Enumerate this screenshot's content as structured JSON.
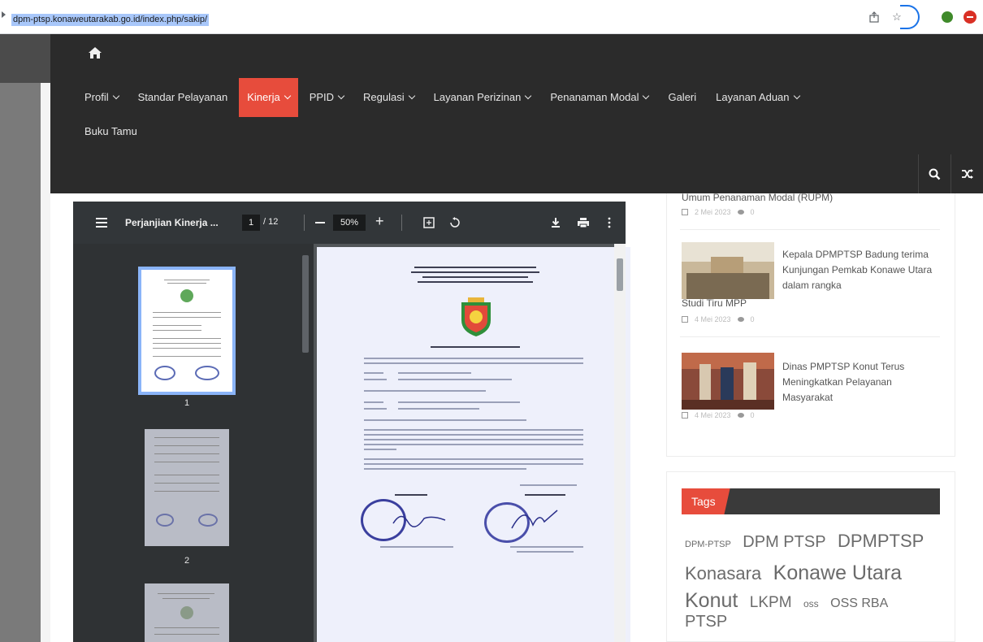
{
  "browser": {
    "url": "dpm-ptsp.konawеutarakab.go.id/index.php/sakip/"
  },
  "navbar": {
    "items": [
      {
        "label": "Profil",
        "has_dropdown": true
      },
      {
        "label": "Standar Pelayanan",
        "has_dropdown": false
      },
      {
        "label": "Kinerja",
        "has_dropdown": true,
        "active": true
      },
      {
        "label": "PPID",
        "has_dropdown": true
      },
      {
        "label": "Regulasi",
        "has_dropdown": true
      },
      {
        "label": "Layanan Perizinan",
        "has_dropdown": true
      },
      {
        "label": "Penanaman Modal",
        "has_dropdown": true
      },
      {
        "label": "Galeri",
        "has_dropdown": false
      },
      {
        "label": "Layanan Aduan",
        "has_dropdown": true
      }
    ],
    "row2_item": "Buku Tamu",
    "accent": "#e74c3c"
  },
  "pdf": {
    "title": "Perjanjian Kinerja ...",
    "page_current": "1",
    "page_total": "/ 12",
    "zoom": "50%",
    "thumb_numbers": [
      "1",
      "2"
    ]
  },
  "sidebar": {
    "cut_title": "Umum Penanaman Modal (RUPM)",
    "meta1": "2 Mei 2023",
    "meta1_comments": "0",
    "news": [
      {
        "title_part1": "Kepala DPMPTSP Badung terima Kunjungan Pemkab Konawe Utara dalam rangka",
        "title_part2": "Studi Tiru MPP",
        "date": "4 Mei 2023",
        "comments": "0"
      },
      {
        "title": "Dinas PMPTSP Konut Terus Meningkatkan Pelayanan Masyarakat",
        "date": "4 Mei 2023",
        "comments": "0"
      }
    ],
    "tags_label": "Tags",
    "tags": [
      "DPM-PTSP",
      "DPM PTSP",
      "DPMPTSP",
      "Konasara",
      "Konawe Utara",
      "Konut",
      "LKPM",
      "oss",
      "OSS RBA",
      "PTSP"
    ]
  }
}
